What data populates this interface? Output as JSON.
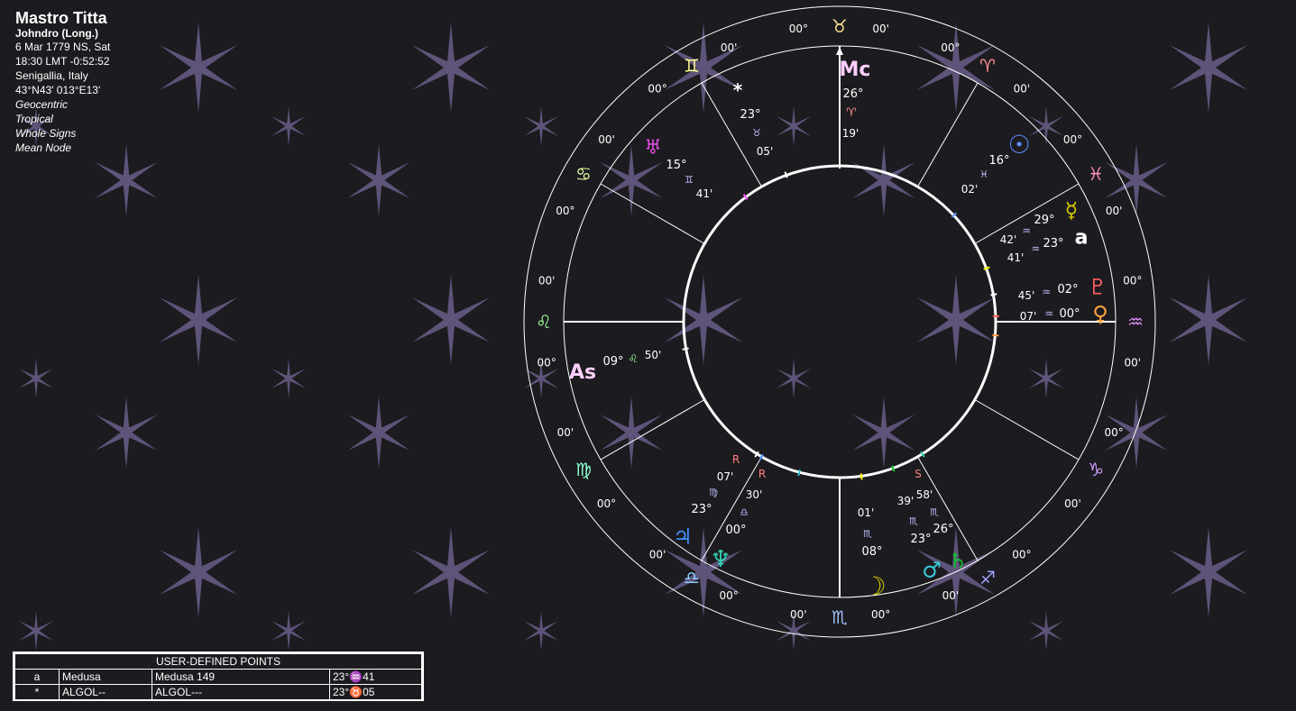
{
  "chart": {
    "name": "Mastro Titta",
    "house_system": "Johndro (Long.)",
    "date": "6 Mar 1779 NS, Sat",
    "time": "18:30  LMT -0:52:52",
    "place": "Senigallia, Italy",
    "coords": "43°N43' 013°E13'",
    "options": [
      "Geocentric",
      "Tropical",
      "Whole Signs",
      "Mean Node"
    ]
  },
  "colors": {
    "background": "#1c1b1f",
    "star": "#5e5379",
    "wheel": "#ffffff",
    "sun": "#5a8cff",
    "moon": "#d8d000",
    "mercury": "#d8c800",
    "venus": "#ffa040",
    "mars": "#38c8d8",
    "jupiter": "#4090ff",
    "saturn": "#10c030",
    "uranus": "#e050e0",
    "neptune": "#30d0b0",
    "pluto": "#ff6060"
  },
  "wheel": {
    "signs": [
      {
        "glyph": "♉",
        "name": "taurus-icon",
        "deg_left": "00°",
        "deg_right": "00'",
        "color": "#ffe090"
      },
      {
        "glyph": "♈",
        "name": "aries-icon",
        "deg_left": "00°",
        "deg_right": "00'",
        "color": "#ff9090"
      },
      {
        "glyph": "♓",
        "name": "pisces-icon",
        "deg_left": "00°",
        "deg_right": "00'",
        "color": "#ff90c0"
      },
      {
        "glyph": "♒",
        "name": "aquarius-icon",
        "deg_left": "00°",
        "deg_right": "00'",
        "color": "#e090ff"
      },
      {
        "glyph": "♑",
        "name": "capricorn-icon",
        "deg_left": "00°",
        "deg_right": "00'",
        "color": "#d0a0ff"
      },
      {
        "glyph": "♐",
        "name": "sagittarius-icon",
        "deg_left": "00°",
        "deg_right": "00'",
        "color": "#a0a0ff"
      },
      {
        "glyph": "♏",
        "name": "scorpio-icon",
        "deg_left": "00°",
        "deg_right": "00'",
        "color": "#a0c0ff"
      },
      {
        "glyph": "♎",
        "name": "libra-icon",
        "deg_left": "00°",
        "deg_right": "00'",
        "color": "#90d0ff"
      },
      {
        "glyph": "♍",
        "name": "virgo-icon",
        "deg_left": "00°",
        "deg_right": "00'",
        "color": "#90ffd0"
      },
      {
        "glyph": "♌",
        "name": "leo-icon",
        "deg_left": "00°",
        "deg_right": "00'",
        "color": "#a0ffa0"
      },
      {
        "glyph": "♋",
        "name": "cancer-icon",
        "deg_left": "00°",
        "deg_right": "00'",
        "color": "#e0ffa0"
      },
      {
        "glyph": "♊",
        "name": "gemini-icon",
        "deg_left": "00°",
        "deg_right": "00'",
        "color": "#ffff90"
      }
    ],
    "angles": {
      "mc": {
        "label": "Mc",
        "deg": "26°",
        "sign": "♈",
        "min": "19'"
      },
      "asc": {
        "label": "As",
        "deg": "09°",
        "sign": "♌",
        "min": "50'"
      }
    },
    "planets": [
      {
        "key": "sun",
        "glyph": "☉",
        "deg": "16°",
        "sign": "♓",
        "min": "02'"
      },
      {
        "key": "mercury",
        "glyph": "☿",
        "deg": "29°",
        "sign": "♒",
        "min": "42'"
      },
      {
        "key": "medusa",
        "glyph": "a",
        "deg": "23°",
        "sign": "♒",
        "min": "41'"
      },
      {
        "key": "pluto",
        "glyph": "♇",
        "deg": "02°",
        "sign": "♒",
        "min": "45'"
      },
      {
        "key": "venus",
        "glyph": "♀",
        "deg": "00°",
        "sign": "♒",
        "min": "07'"
      },
      {
        "key": "uranus",
        "glyph": "♅",
        "deg": "15°",
        "sign": "♊",
        "min": "41'"
      },
      {
        "key": "algol",
        "glyph": "*",
        "deg": "23°",
        "sign": "♉",
        "min": "05'"
      },
      {
        "key": "jupiter",
        "glyph": "♃",
        "deg": "23°",
        "sign": "♍",
        "min": "07'",
        "retro": "R"
      },
      {
        "key": "neptune",
        "glyph": "♆",
        "deg": "00°",
        "sign": "♎",
        "min": "30'",
        "retro": "R"
      },
      {
        "key": "moon",
        "glyph": "☽",
        "deg": "08°",
        "sign": "♏",
        "min": "01'"
      },
      {
        "key": "mars",
        "glyph": "♂",
        "deg": "23°",
        "sign": "♏",
        "min": "39'"
      },
      {
        "key": "saturn",
        "glyph": "♄",
        "deg": "26°",
        "sign": "♏",
        "min": "58'",
        "retro": "S"
      }
    ]
  },
  "user_points": {
    "header": "USER-DEFINED POINTS",
    "rows": [
      {
        "sym": "a",
        "name": "Medusa",
        "full": "Medusa 149",
        "pos": "23°♒41"
      },
      {
        "sym": "*",
        "name": "ALGOL--",
        "full": "ALGOL---",
        "pos": "23°♉05"
      }
    ]
  }
}
